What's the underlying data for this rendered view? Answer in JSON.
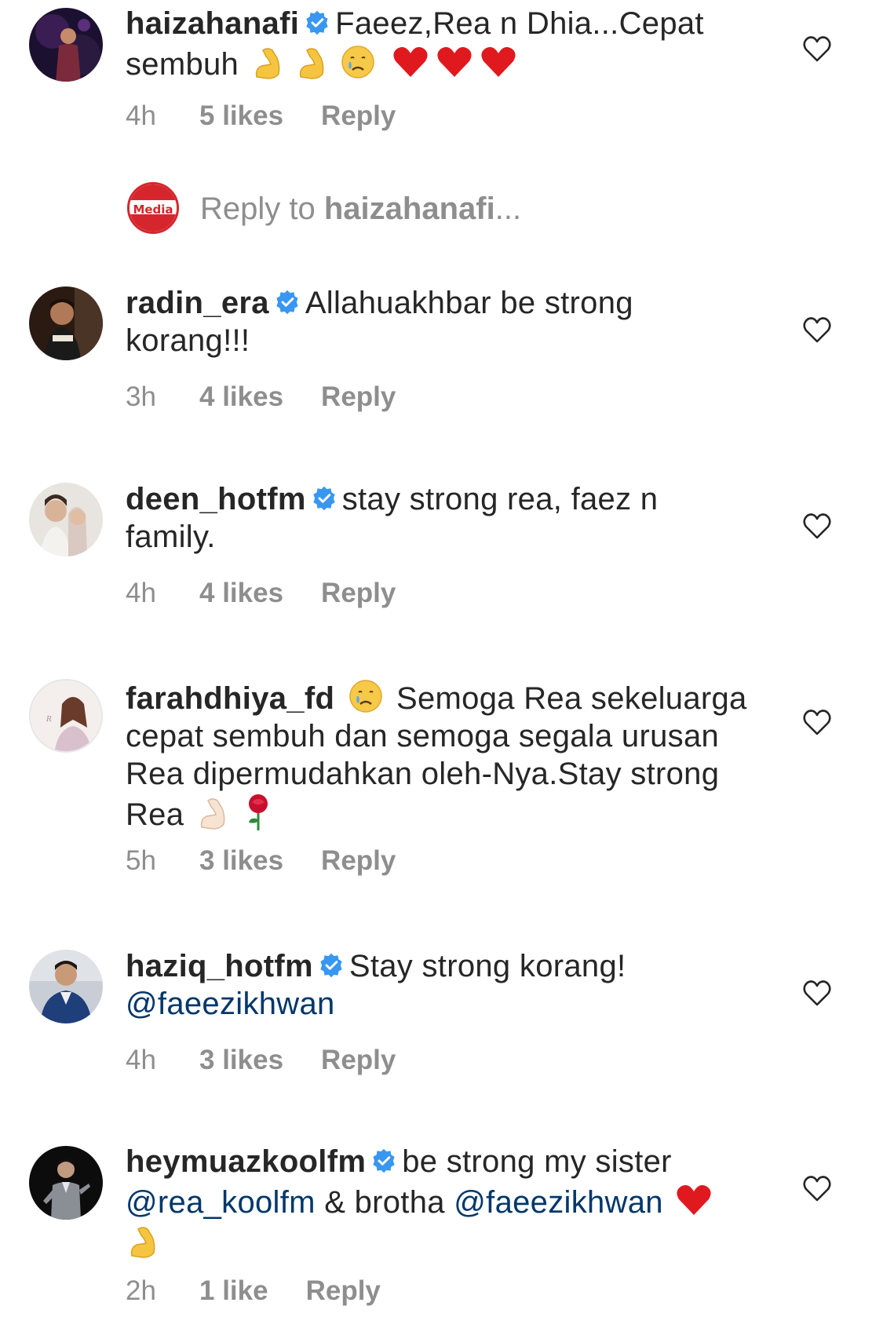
{
  "comments": [
    {
      "username": "haizahanafi",
      "verified": true,
      "text": "Faeez,Rea n Dhia...Cepat sembuh",
      "emojis": [
        "flexed-biceps",
        "flexed-biceps",
        "crying-face",
        "red-heart",
        "red-heart",
        "red-heart"
      ],
      "time": "4h",
      "likes": "5 likes",
      "reply": "Reply"
    },
    {
      "username": "radin_era",
      "verified": true,
      "text": "Allahuakhbar be strong korang!!!",
      "time": "3h",
      "likes": "4 likes",
      "reply": "Reply"
    },
    {
      "username": "deen_hotfm",
      "verified": true,
      "text": "stay strong rea, faez n family.",
      "time": "4h",
      "likes": "4 likes",
      "reply": "Reply"
    },
    {
      "username": "farahdhiya_fd",
      "verified": false,
      "text_before_emoji": "Semoga Rea sekeluarga cepat sembuh dan semoga segala urusan Rea dipermudahkan oleh-Nya.Stay strong Rea",
      "emojis": [
        "crying-face",
        "flexed-biceps-light",
        "rose"
      ],
      "time": "5h",
      "likes": "3 likes",
      "reply": "Reply"
    },
    {
      "username": "haziq_hotfm",
      "verified": true,
      "text": "Stay strong korang!",
      "mention": "@faeezikhwan",
      "time": "4h",
      "likes": "3 likes",
      "reply": "Reply"
    },
    {
      "username": "heymuazkoolfm",
      "verified": true,
      "text": "be strong my sister",
      "mention_1": "@rea_koolfm",
      "middle": "& brotha",
      "mention_2": "@faeezikhwan",
      "emojis": [
        "red-heart",
        "flexed-biceps"
      ],
      "time": "2h",
      "likes": "1 like",
      "reply": "Reply"
    }
  ],
  "reply_prompt": {
    "prefix": "Reply to",
    "target": "haizahanafi",
    "suffix": "...",
    "logo_text": "Media"
  },
  "colors": {
    "text": "#262626",
    "secondary": "#8e8e8e",
    "verified_blue": "#3897f0",
    "mention": "#00376b",
    "brand_red": "#d6262d"
  },
  "icons": {
    "like": "heart-outline-icon",
    "verified": "verified-badge-icon"
  }
}
